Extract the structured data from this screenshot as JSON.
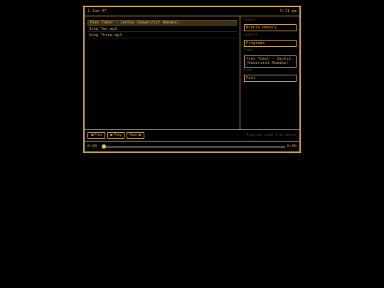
{
  "titlebar": {
    "date": "1-Jan-97",
    "time": "5:11 pm"
  },
  "playlist": {
    "tracks": [
      {
        "label": "Yves Tumor - Jackie (Gewerzivt Remake)",
        "active": true
      },
      {
        "label": "Song Two.mp3",
        "active": false
      },
      {
        "label": "Song Three.mp3",
        "active": false
      }
    ]
  },
  "details": {
    "fields": [
      {
        "label": "Jackie",
        "value": "Bubble Memory"
      },
      {
        "label": "Subject",
        "value": "Programs"
      },
      {
        "label": "Title",
        "value": "Yves Tumor - Jackie (Gewerzivt Remake)"
      },
      {
        "label": "Find",
        "value": "Font"
      }
    ]
  },
  "controls": {
    "prev_label": "◀ Prev",
    "play_label": "▶ Play",
    "next_label": "Next ▶",
    "note": "Playlist loads from server"
  },
  "progress": {
    "current": "0:00",
    "total": "0:00",
    "fraction": 0.0
  },
  "colors": {
    "accent": "#c9a24a",
    "background": "#000000"
  }
}
